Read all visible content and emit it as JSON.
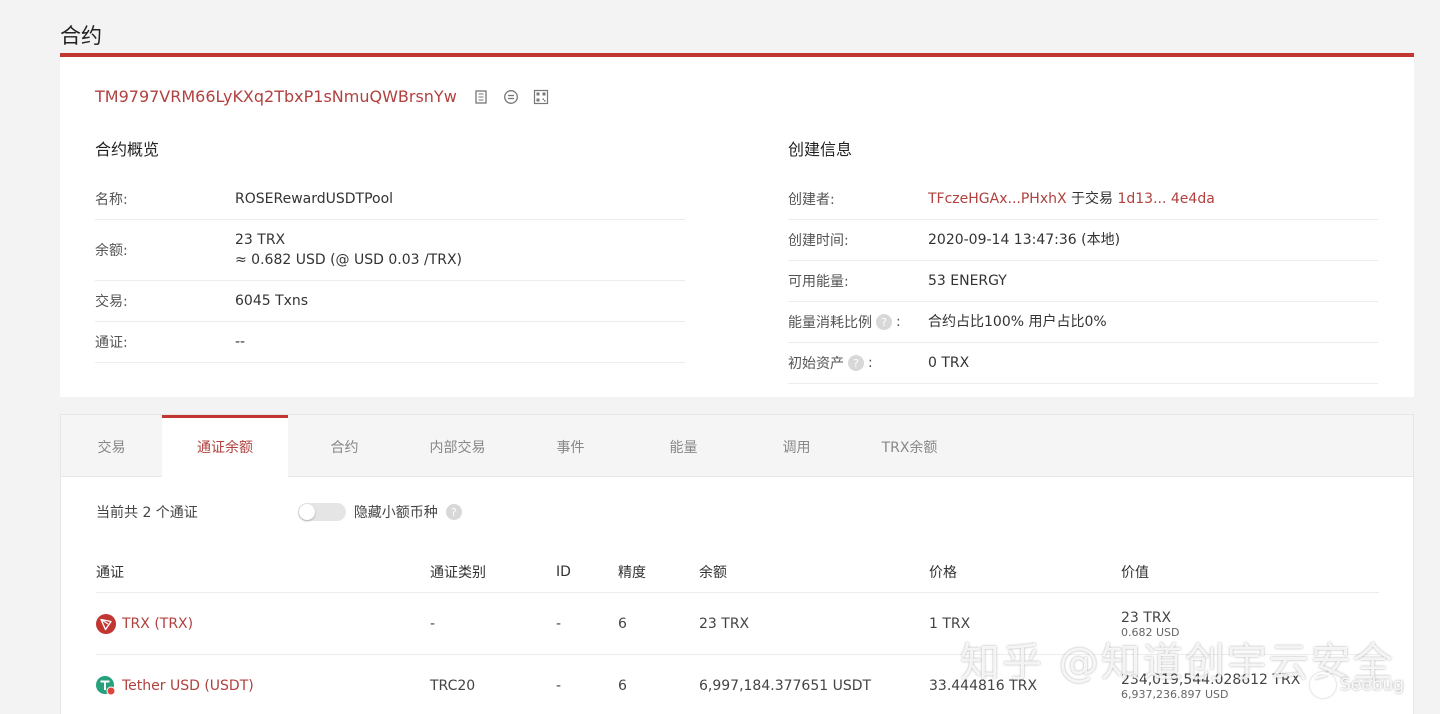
{
  "page": {
    "title": "合约"
  },
  "contract": {
    "address": "TM9797VRM66LyKXq2TbxP1sNmuQWBrsnYw"
  },
  "overview": {
    "heading": "合约概览",
    "rows": [
      {
        "label": "名称:",
        "value": "ROSERewardUSDTPool"
      },
      {
        "label": "余额:",
        "value": "23 TRX",
        "sub": "≈ 0.682 USD (@ USD 0.03 /TRX)"
      },
      {
        "label": "交易:",
        "value": "6045  Txns"
      },
      {
        "label": "通证:",
        "value": "--"
      }
    ]
  },
  "creation": {
    "heading": "创建信息",
    "creator_label": "创建者:",
    "creator_addr": "TFczeHGAx...PHxhX",
    "creator_mid": " 于交易 ",
    "creator_tx": "1d13... 4e4da",
    "time_label": "创建时间:",
    "time_value": "2020-09-14 13:47:36 (本地)",
    "energy_label": "可用能量:",
    "energy_value": "53  ENERGY",
    "ratio_label": "能量消耗比例",
    "ratio_value": "合约占比100%  用户占比0%",
    "initial_label": "初始资产",
    "initial_value": "0 TRX",
    "colon": ":",
    "q": "?"
  },
  "tabs": [
    "交易",
    "通证余额",
    "合约",
    "内部交易",
    "事件",
    "能量",
    "调用",
    "TRX余额"
  ],
  "tokens": {
    "summary": "当前共 2 个通证",
    "toggle_label": "隐藏小额币种",
    "q": "?",
    "headers": [
      "通证",
      "通证类别",
      "ID",
      "精度",
      "余额",
      "价格",
      "价值"
    ],
    "rows": [
      {
        "name": "TRX (TRX)",
        "icon": "tron-icon",
        "type": "-",
        "id": "-",
        "precision": "6",
        "balance": "23 TRX",
        "price": "1 TRX",
        "value": "23 TRX",
        "value_usd": "0.682 USD"
      },
      {
        "name": "Tether USD (USDT)",
        "icon": "tether-icon",
        "type": "TRC20",
        "id": "-",
        "precision": "6",
        "balance": "6,997,184.377651 USDT",
        "price": "33.444816 TRX",
        "value": "234,019,544.028612 TRX",
        "value_usd": "6,937,236.897 USD"
      }
    ]
  },
  "watermark": {
    "text": "知乎 @知道创宇云安全",
    "brand": "Seebug"
  },
  "colors": {
    "accent": "#c23631",
    "link": "#b0413e",
    "tether": "#26a17b"
  }
}
